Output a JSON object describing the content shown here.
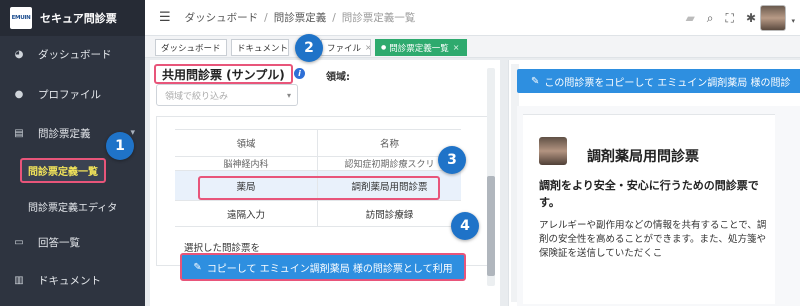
{
  "app": {
    "logo_text": "EMUIN",
    "title": "セキュア問診票"
  },
  "sidebar": {
    "items": [
      {
        "label": "ダッシュボード",
        "icon": "dashboard-icon"
      },
      {
        "label": "プロファイル",
        "icon": "user-icon"
      },
      {
        "label": "問診票定義",
        "icon": "document-icon",
        "expanded": true
      },
      {
        "label": "回答一覧",
        "icon": "inbox-icon"
      },
      {
        "label": "ドキュメント",
        "icon": "file-icon"
      }
    ],
    "subitems": [
      {
        "label": "問診票定義一覧",
        "active": true
      },
      {
        "label": "問診票定義エディタ"
      }
    ]
  },
  "header": {
    "breadcrumb": [
      "ダッシュボード",
      "問診票定義",
      "問診票定義一覧"
    ]
  },
  "tabs": [
    {
      "label": "ダッシュボード"
    },
    {
      "label": "ドキュメント"
    },
    {
      "label": "ファイル"
    },
    {
      "label": "問診票定義一覧",
      "active": true
    }
  ],
  "left": {
    "title": "共用問診票 (サンプル)",
    "domain_label": "領域:",
    "filter_placeholder": "領域で絞り込み",
    "table": {
      "headers": [
        "領域",
        "名称"
      ],
      "partial_row": [
        "脳神経内科",
        "認知症初期診療スクリ"
      ],
      "rows": [
        {
          "domain": "薬局",
          "name": "調剤薬局用問診票",
          "selected": true
        },
        {
          "domain": "遠隔入力",
          "name": "訪問診療録"
        }
      ]
    },
    "selected_text": "選択した問診票を",
    "use_button": "コピーして エミュイン調剤薬局 様の問診票として利用"
  },
  "right": {
    "copy_button": "この問診票をコピーして エミュイン調剤薬局 様の問診",
    "preview": {
      "title": "調剤薬局用問診票",
      "subtitle": "調剤をより安全・安心に行うための問診票です。",
      "body": "アレルギーや副作用などの情報を共有することで、調剤の安全性を高めることができます。また、処方箋や保険証を送信していただくこ"
    }
  },
  "badges": [
    "1",
    "2",
    "3",
    "4"
  ],
  "colors": {
    "sidebar": "#2e3440",
    "accent": "#2e8fe0",
    "highlight": "#e8557a",
    "active_tab": "#2eaa6e",
    "badge": "#1f73c8"
  }
}
